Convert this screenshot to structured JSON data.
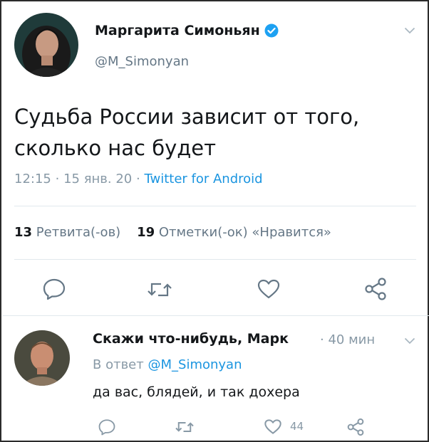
{
  "tweet": {
    "author_name": "Маргарита Симоньян",
    "handle": "@M_Simonyan",
    "text_line1": "Судьба России зависит от того,",
    "text_line2": "сколько нас будет",
    "time": "12:15",
    "dot1": "·",
    "date": "15 янв. 20",
    "dot2": "·",
    "source": "Twitter for Android",
    "retweets_count": "13",
    "retweets_label": "Ретвита(-ов)",
    "likes_count": "19",
    "likes_label": "Отметки(-ок) «Нравится»"
  },
  "reply": {
    "author_name": "Скажи что-нибудь, Марк",
    "time": "· 40 мин",
    "reply_prefix": "В ответ",
    "reply_mention": "@M_Simonyan",
    "text": "да вас, блядей, и так дохера",
    "like_count": "44"
  },
  "colors": {
    "text": "#14171a",
    "secondary": "#657786",
    "muted": "#8899a6",
    "link": "#1b95e0",
    "divider": "#e1e8ed"
  },
  "icons": [
    "verified-badge-icon",
    "chevron-down-icon",
    "reply-icon",
    "retweet-icon",
    "like-icon",
    "share-icon"
  ]
}
